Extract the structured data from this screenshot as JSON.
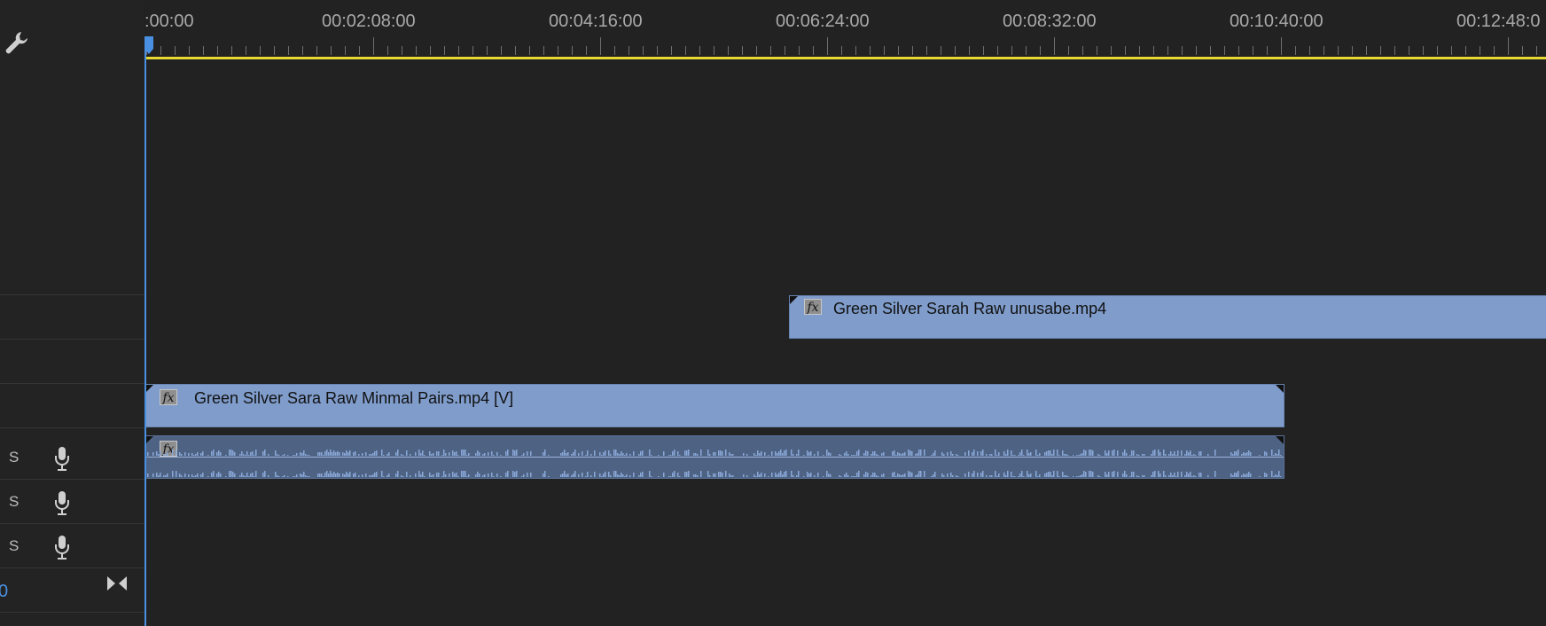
{
  "colors": {
    "playhead": "#4a90e2",
    "work_area_bar": "#e8d830",
    "clip_fill": "#7f9ccb",
    "audio_clip_fill": "#4e6384",
    "waveform": "#8aa8d8"
  },
  "ruler": {
    "labels": [
      ":00:00",
      "00:02:08:00",
      "00:04:16:00",
      "00:06:24:00",
      "00:08:32:00",
      "00:10:40:00",
      "00:12:48:0"
    ]
  },
  "tools": {
    "settings_icon": "wrench-icon"
  },
  "tracks": {
    "video_clips": [
      {
        "fx": "fx",
        "name": "Green Silver Sarah Raw unusabe.mp4"
      },
      {
        "fx": "fx",
        "name": "Green Silver Sara Raw Minmal Pairs.mp4 [V]"
      }
    ],
    "audio_clip": {
      "fx": "fx"
    },
    "audio_headers": [
      {
        "solo": "S",
        "mic_icon": "microphone-icon"
      },
      {
        "solo": "S",
        "mic_icon": "microphone-icon"
      },
      {
        "solo": "S",
        "mic_icon": "microphone-icon"
      }
    ],
    "master": {
      "value": "0",
      "icon": "bowtie-icon"
    }
  }
}
